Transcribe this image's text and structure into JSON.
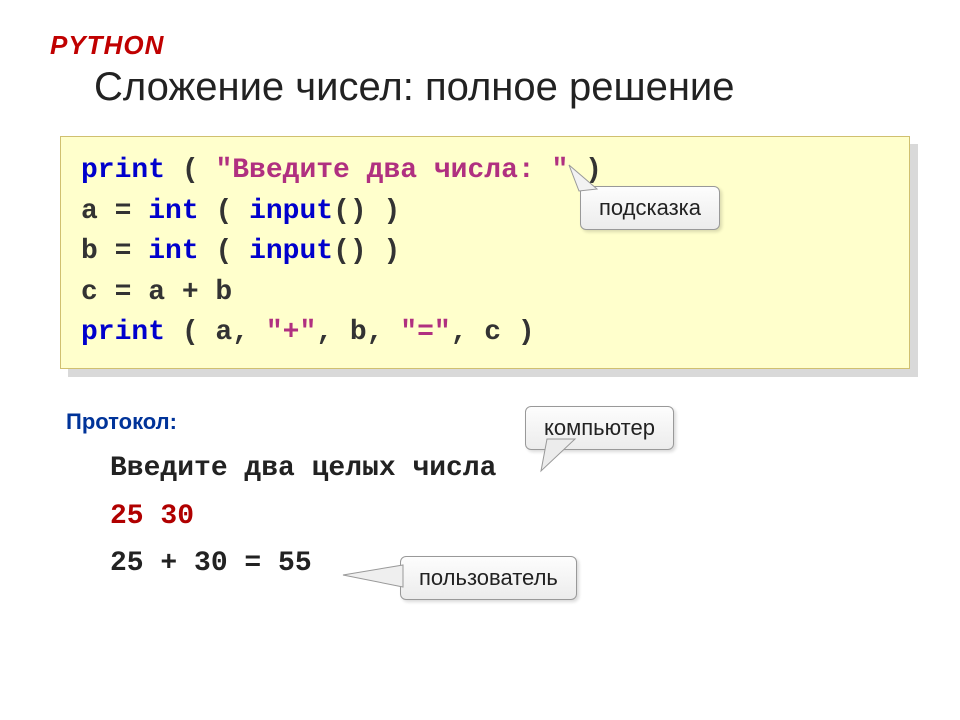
{
  "header": {
    "topic": "PYTHON",
    "title": "Сложение чисел: полное решение"
  },
  "code": {
    "l1_kw": "print",
    "l1_p1": " ( ",
    "l1_str": "\"Введите два числа: \"",
    "l1_p2": " )",
    "l2_a": "a = ",
    "l2_kw": "int",
    "l2_b": " ( ",
    "l2_kw2": "input",
    "l2_c": "() )",
    "l3_a": "b = ",
    "l3_kw": "int",
    "l3_b": " ( ",
    "l3_kw2": "input",
    "l3_c": "() )",
    "l4": "c = a + b",
    "l5_kw": "print",
    "l5_a": " ( a, ",
    "l5_s1": "\"+\"",
    "l5_b": ", b, ",
    "l5_s2": "\"=\"",
    "l5_c": ", c )"
  },
  "callouts": {
    "hint": "подсказка",
    "computer": "компьютер",
    "user": "пользователь"
  },
  "protocol": {
    "label": "Протокол:",
    "line1": "Введите два целых числа",
    "line2": "25 30",
    "line3": "25 + 30 = 55"
  }
}
